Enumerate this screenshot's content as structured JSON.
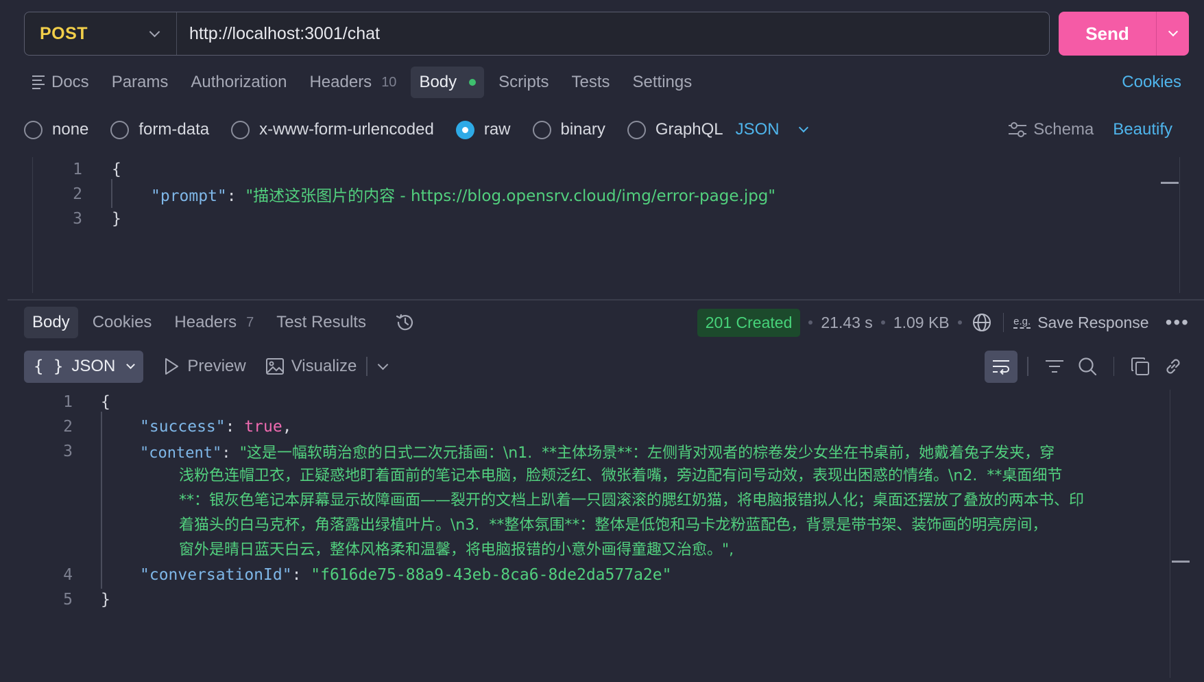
{
  "request": {
    "method": "POST",
    "url": "http://localhost:3001/chat",
    "send_label": "Send"
  },
  "request_tabs": {
    "docs": "Docs",
    "params": "Params",
    "authorization": "Authorization",
    "headers": "Headers",
    "headers_count": "10",
    "body": "Body",
    "scripts": "Scripts",
    "tests": "Tests",
    "settings": "Settings",
    "cookies": "Cookies"
  },
  "body_types": {
    "none": "none",
    "form_data": "form-data",
    "urlencoded": "x-www-form-urlencoded",
    "raw": "raw",
    "binary": "binary",
    "graphql": "GraphQL",
    "selected": "raw",
    "language": "JSON",
    "schema": "Schema",
    "beautify": "Beautify"
  },
  "request_body": {
    "line_numbers": [
      "1",
      "2",
      "3"
    ],
    "open": "{",
    "key": "\"prompt\"",
    "colon": ": ",
    "value": "\"描述这张图片的内容 - https://blog.opensrv.cloud/img/error-page.jpg\"",
    "close": "}"
  },
  "response_tabs": {
    "body": "Body",
    "cookies": "Cookies",
    "headers": "Headers",
    "headers_count": "7",
    "test_results": "Test Results"
  },
  "response_meta": {
    "status": "201 Created",
    "time": "21.43 s",
    "size": "1.09 KB",
    "save_response": "Save Response",
    "example_icon_text": "e.g."
  },
  "response_toolbar": {
    "format": "JSON",
    "preview": "Preview",
    "visualize": "Visualize"
  },
  "response_body": {
    "line_numbers": [
      "1",
      "2",
      "3",
      "4",
      "5"
    ],
    "open": "{",
    "success_key": "\"success\"",
    "success_value": "true",
    "content_key": "\"content\"",
    "content_lines": [
      "\"这是一幅软萌治愈的日式二次元插画：\\n1.  **主体场景**：左侧背对观者的棕卷发少女坐在书桌前，她戴着兔子发夹，穿",
      "浅粉色连帽卫衣，正疑惑地盯着面前的笔记本电脑，脸颊泛红、微张着嘴，旁边配有问号动效，表现出困惑的情绪。\\n2.  **桌面细节",
      "**：银灰色笔记本屏幕显示故障画面——裂开的文档上趴着一只圆滚滚的腮红奶猫，将电脑报错拟人化；桌面还摆放了叠放的两本书、印",
      "着猫头的白马克杯，角落露出绿植叶片。\\n3.  **整体氛围**：整体是低饱和马卡龙粉蓝配色，背景是带书架、装饰画的明亮房间，",
      "窗外是晴日蓝天白云，整体风格柔和温馨，将电脑报错的小意外画得童趣又治愈。\","
    ],
    "conv_key": "\"conversationId\"",
    "conv_value": "\"f616de75-88a9-43eb-8ca6-8de2da577a2e\"",
    "close": "}"
  },
  "colors": {
    "accent": "#f55ba6",
    "link": "#4fb5ec",
    "method": "#f2cf4a",
    "status_ok": "#47d37a",
    "string": "#52d07e",
    "key": "#7fb7e8",
    "boolean": "#ef6bb1"
  }
}
